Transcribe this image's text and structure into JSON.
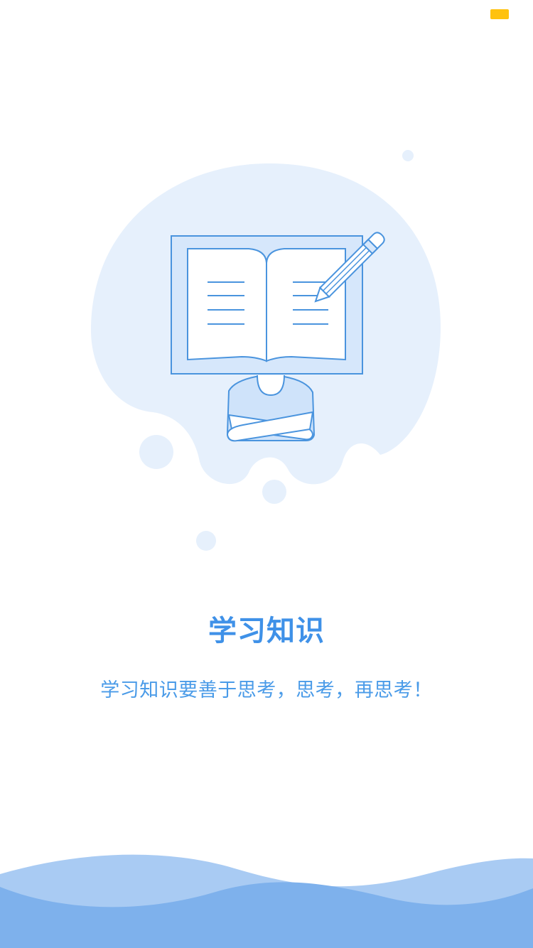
{
  "status_bar": {
    "indicator_color": "#ffc20e"
  },
  "illustration": {
    "icon": "reader-with-book-and-pencil-icon",
    "bubble_color": "#e6f0fc",
    "line_color": "#4a94de"
  },
  "content": {
    "title": "学习知识",
    "subtitle": "学习知识要善于思考，思考，再思考！"
  },
  "colors": {
    "title": "#3f91e8",
    "subtitle": "#4a9be8",
    "wave_back": "#a9cbf3",
    "wave_front": "#7eb1ec"
  }
}
